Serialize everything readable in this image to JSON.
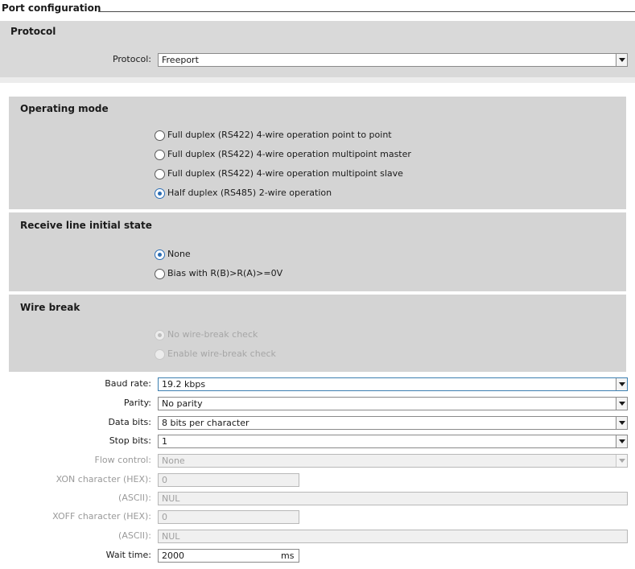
{
  "header": {
    "title": "Port configuration"
  },
  "protocol_section": {
    "title": "Protocol",
    "protocol_label": "Protocol:",
    "protocol_value": "Freeport"
  },
  "operating_mode": {
    "title": "Operating mode",
    "options": [
      {
        "label": "Full duplex (RS422) 4-wire operation point to point",
        "checked": false
      },
      {
        "label": "Full duplex (RS422) 4-wire operation multipoint master",
        "checked": false
      },
      {
        "label": "Full duplex (RS422) 4-wire operation multipoint slave",
        "checked": false
      },
      {
        "label": "Half duplex (RS485) 2-wire operation",
        "checked": true
      }
    ]
  },
  "receive_line": {
    "title": "Receive line initial state",
    "options": [
      {
        "label": "None",
        "checked": true
      },
      {
        "label": "Bias with R(B)>R(A)>=0V",
        "checked": false
      }
    ]
  },
  "wire_break": {
    "title": "Wire break",
    "options": [
      {
        "label": "No wire-break check",
        "checked": true,
        "disabled": true
      },
      {
        "label": "Enable wire-break check",
        "checked": false,
        "disabled": true
      }
    ]
  },
  "fields": {
    "baud_rate": {
      "label": "Baud rate:",
      "value": "19.2 kbps"
    },
    "parity": {
      "label": "Parity:",
      "value": "No parity"
    },
    "data_bits": {
      "label": "Data bits:",
      "value": "8 bits per character"
    },
    "stop_bits": {
      "label": "Stop bits:",
      "value": "1"
    },
    "flow_control": {
      "label": "Flow control:",
      "value": "None"
    },
    "xon_hex": {
      "label": "XON character (HEX):",
      "value": "0"
    },
    "xon_ascii": {
      "label": "(ASCII):",
      "value": "NUL"
    },
    "xoff_hex": {
      "label": "XOFF character (HEX):",
      "value": "0"
    },
    "xoff_ascii": {
      "label": "(ASCII):",
      "value": "NUL"
    },
    "wait_time": {
      "label": "Wait time:",
      "value": "2000",
      "unit": "ms"
    }
  },
  "colors": {
    "panel_bg": "#d9d9d9",
    "accent": "#2a6db5",
    "disabled_text": "#a0a0a0"
  }
}
